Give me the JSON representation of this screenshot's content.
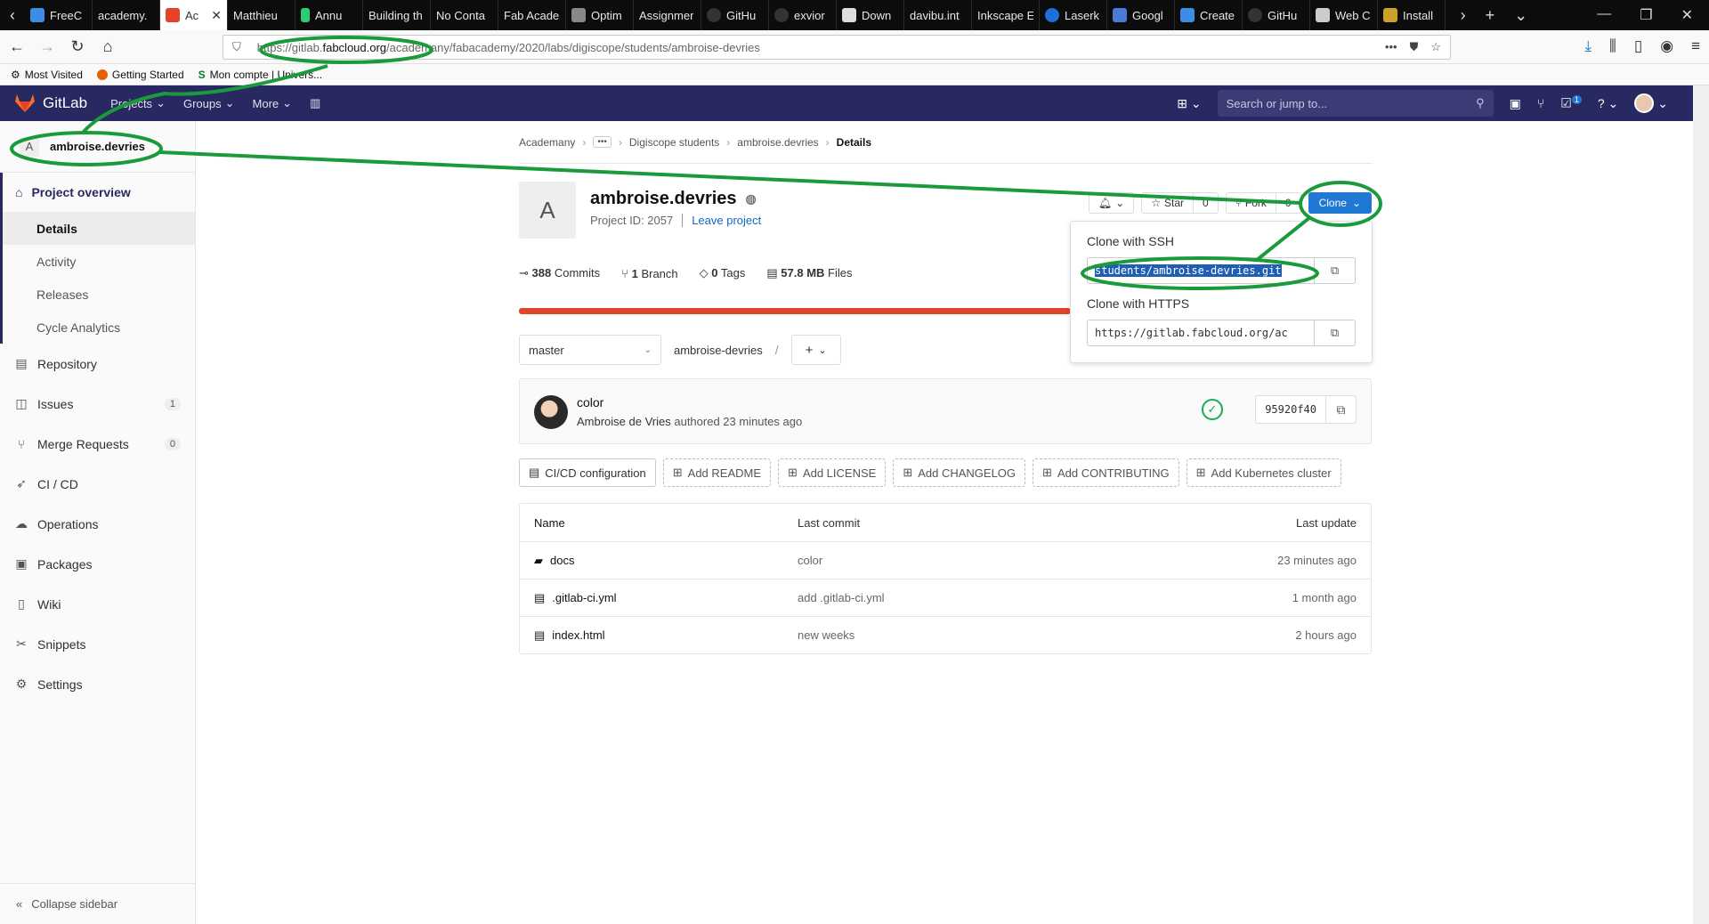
{
  "browser": {
    "tabs": [
      {
        "label": "FreeC",
        "color": "#3a8ee6"
      },
      {
        "label": "academy.",
        "color": "#0c0c0d"
      },
      {
        "label": "Ac",
        "color": "#e24329"
      },
      {
        "label": "Matthieu",
        "color": "#0c0c0d"
      },
      {
        "label": "Annu",
        "color": "#2ecc71"
      },
      {
        "label": "Building th",
        "color": "#0c0c0d"
      },
      {
        "label": "No Conta",
        "color": "#0c0c0d"
      },
      {
        "label": "Fab Acade",
        "color": "#0c0c0d"
      },
      {
        "label": "Optim",
        "color": "#888888"
      },
      {
        "label": "Assignmer",
        "color": "#0c0c0d"
      },
      {
        "label": "GitHu",
        "color": "#333333"
      },
      {
        "label": "exvior",
        "color": "#333333"
      },
      {
        "label": "Down",
        "color": "#dddddd"
      },
      {
        "label": "davibu.int",
        "color": "#0c0c0d"
      },
      {
        "label": "Inkscape E",
        "color": "#0c0c0d"
      },
      {
        "label": "Laserk",
        "color": "#1e6fd9"
      },
      {
        "label": "Googl",
        "color": "#4a7bd6"
      },
      {
        "label": "Create",
        "color": "#3a8ee6"
      },
      {
        "label": "GitHu",
        "color": "#333333"
      },
      {
        "label": "Web C",
        "color": "#cccccc"
      },
      {
        "label": "Install",
        "color": "#c9a227"
      }
    ],
    "url_host_prefix": "https://gitlab.",
    "url_host_domain": "fabcloud.org",
    "url_path": "/academany/fabacademy/2020/labs/digiscope/students/ambroise-devries",
    "bookmarks": [
      "Most Visited",
      "Getting Started",
      "Mon compte | Univers..."
    ]
  },
  "gitlab": {
    "brand": "GitLab",
    "menu": [
      "Projects",
      "Groups",
      "More"
    ],
    "search_placeholder": "Search or jump to...",
    "todo_count": "1"
  },
  "sidebar": {
    "project_initial": "A",
    "project_name": "ambroise.devries",
    "overview": "Project overview",
    "sub_items": [
      "Details",
      "Activity",
      "Releases",
      "Cycle Analytics"
    ],
    "items": [
      {
        "label": "Repository",
        "icon": "file-icon"
      },
      {
        "label": "Issues",
        "icon": "issues-icon",
        "badge": "1"
      },
      {
        "label": "Merge Requests",
        "icon": "merge-request-icon",
        "badge": "0"
      },
      {
        "label": "CI / CD",
        "icon": "rocket-icon"
      },
      {
        "label": "Operations",
        "icon": "cloud-icon"
      },
      {
        "label": "Packages",
        "icon": "package-icon"
      },
      {
        "label": "Wiki",
        "icon": "book-icon"
      },
      {
        "label": "Snippets",
        "icon": "scissors-icon"
      },
      {
        "label": "Settings",
        "icon": "gear-icon"
      }
    ],
    "collapse": "Collapse sidebar"
  },
  "breadcrumb": [
    "Academany",
    "Digiscope students",
    "ambroise.devries",
    "Details"
  ],
  "project": {
    "initial": "A",
    "name": "ambroise.devries",
    "id_text": "Project ID: 2057",
    "leave": "Leave project",
    "stats": {
      "commits_n": "388",
      "commits_l": "Commits",
      "branch_n": "1",
      "branch_l": "Branch",
      "tags_n": "0",
      "tags_l": "Tags",
      "files_n": "57.8 MB",
      "files_l": "Files"
    },
    "star_label": "Star",
    "star_count": "0",
    "fork_label": "Fork",
    "fork_count": "0",
    "clone_label": "Clone"
  },
  "clone_menu": {
    "ssh_label": "Clone with SSH",
    "ssh_value": "students/ambroise-devries.git",
    "https_label": "Clone with HTTPS",
    "https_value": "https://gitlab.fabcloud.org/ac"
  },
  "branch": {
    "name": "master",
    "path": "ambroise-devries",
    "sep": "/"
  },
  "last_commit": {
    "title": "color",
    "author": "Ambroise de Vries",
    "action": "authored 23 minutes ago",
    "sha": "95920f40"
  },
  "quick_actions": [
    "CI/CD configuration",
    "Add README",
    "Add LICENSE",
    "Add CHANGELOG",
    "Add CONTRIBUTING",
    "Add Kubernetes cluster"
  ],
  "files": {
    "headers": [
      "Name",
      "Last commit",
      "Last update"
    ],
    "rows": [
      {
        "name": "docs",
        "commit": "color",
        "date": "23 minutes ago",
        "type": "folder"
      },
      {
        "name": ".gitlab-ci.yml",
        "commit": "add .gitlab-ci.yml",
        "date": "1 month ago",
        "type": "file"
      },
      {
        "name": "index.html",
        "commit": "new weeks",
        "date": "2 hours ago",
        "type": "file"
      }
    ]
  },
  "colors": {
    "header": "#292961",
    "clone_button": "#1f78d1",
    "annotation": "#1a9a3a",
    "language_bar": "#e24329"
  }
}
